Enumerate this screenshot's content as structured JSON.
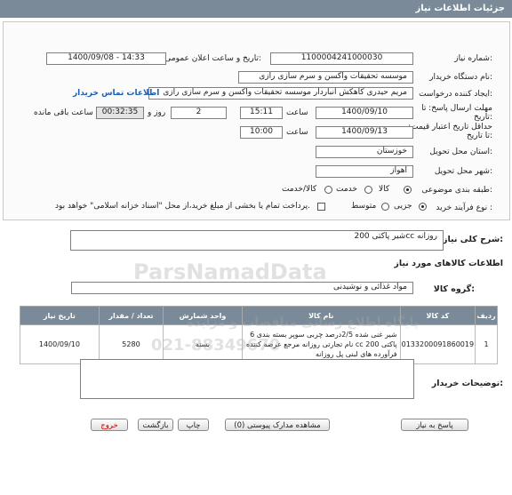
{
  "header": {
    "title": "جزئیات اطلاعات نیاز"
  },
  "form": {
    "need_number_label": "شماره نیاز:",
    "need_number": "1100004241000030",
    "announce_label": "تاریخ و ساعت اعلان عمومی:",
    "announce_value": "1400/09/08 - 14:33",
    "buyer_org_label": "نام دستگاه خریدار:",
    "buyer_org": "موسسه تحقیقات واکسن و سرم سازی رازی",
    "creator_label": "ایجاد کننده درخواست:",
    "creator": "مریم حیدری کاهکش انباردار موسسه تحقیقات واکسن و سرم سازی رازی",
    "contact_link": "اطلاعات تماس خریدار",
    "deadline_label": "مهلت ارسال پاسخ: تا تاریخ:",
    "deadline_date": "1400/09/10",
    "time_label": "ساعت",
    "deadline_time": "15:11",
    "days_value": "2",
    "days_label": "روز و",
    "remaining_time": "00:32:35",
    "remaining_label": "ساعت باقی مانده",
    "validity_label": "حداقل تاریخ اعتبار قیمت: تا تاریخ:",
    "validity_date": "1400/09/13",
    "validity_time": "10:00",
    "province_label": "استان محل تحویل:",
    "province": "خوزستان",
    "city_label": "شهر محل تحویل:",
    "city": "اهواز",
    "category_label": "طبقه بندی موضوعی:",
    "category_options": [
      "کالا",
      "خدمت",
      "کالا/خدمت"
    ],
    "category_selected": "کالا",
    "process_label": "نوع فرآیند خرید :",
    "process_options": [
      "جزیی",
      "متوسط"
    ],
    "process_selected": "جزیی",
    "payment_note": "پرداخت تمام یا بخشی از مبلغ خرید،از محل \"اسناد خزانه اسلامی\" خواهد بود."
  },
  "summary": {
    "label": "شرح کلی نیاز:",
    "value": "شیر پاکتی 200cc روزانه"
  },
  "goods": {
    "section_title": "اطلاعات کالاهای مورد نیاز",
    "group_label": "گروه کالا:",
    "group_value": "مواد غذائی و نوشیدنی",
    "columns": [
      "ردیف",
      "کد کالا",
      "نام کالا",
      "واحد شمارش",
      "تعداد / مقدار",
      "تاریخ نیاز"
    ],
    "rows": [
      {
        "row": "1",
        "code": "0133200091860019",
        "name": "شیر غنی شده 2/5درصد چربی سوپر بسته بندی 6 پاکتی 200 cc نام تجارتی روزانه مرجع عرضه کننده فرآورده های لبنی پل روزانه",
        "unit": "بسته",
        "qty": "5280",
        "date": "1400/09/10"
      }
    ]
  },
  "buyer_notes": {
    "label": "توضیحات خریدار:",
    "value": ""
  },
  "buttons": {
    "reply": "پاسخ به نیاز",
    "attachments": "مشاهده مدارک پیوستی (0)",
    "print": "چاپ",
    "back": "بازگشت",
    "exit": "خروج"
  },
  "watermark": {
    "text1": "ParsNamadData",
    "text2": "پایگاه اطلاع رسانی مناقصات و مزایده",
    "text3": "021-88349670"
  }
}
